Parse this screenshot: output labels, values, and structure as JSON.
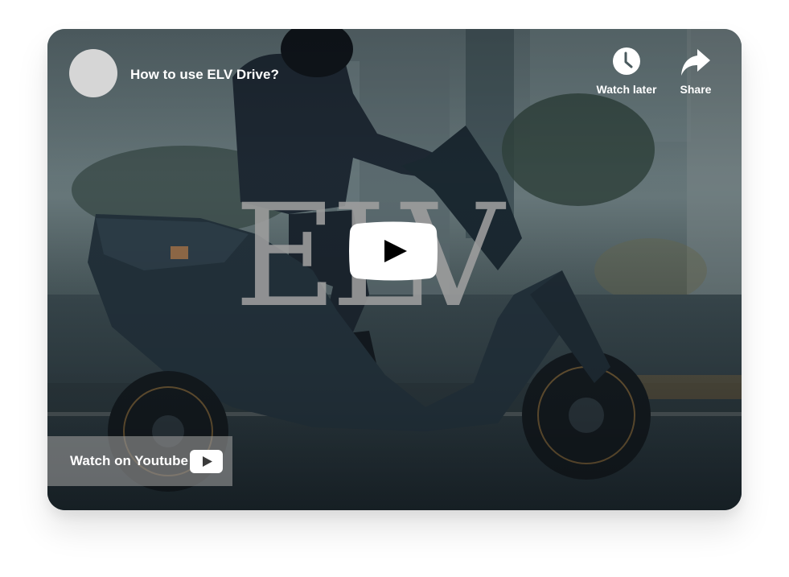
{
  "video": {
    "title": "How to use ELV Drive?",
    "watermark": "ELV"
  },
  "actions": {
    "watch_later_label": "Watch later",
    "share_label": "Share",
    "watch_on_youtube_label": "Watch on Youtube"
  },
  "icons": {
    "watch_later": "clock-icon",
    "share": "share-arrow-icon",
    "play": "youtube-play-icon",
    "youtube_logo": "youtube-logo-icon"
  },
  "colors": {
    "overlay_text": "#ffffff",
    "avatar": "#d6d6d6",
    "play_button": "#ffffff",
    "play_triangle": "#000000",
    "watch_on_bar": "#969696"
  }
}
